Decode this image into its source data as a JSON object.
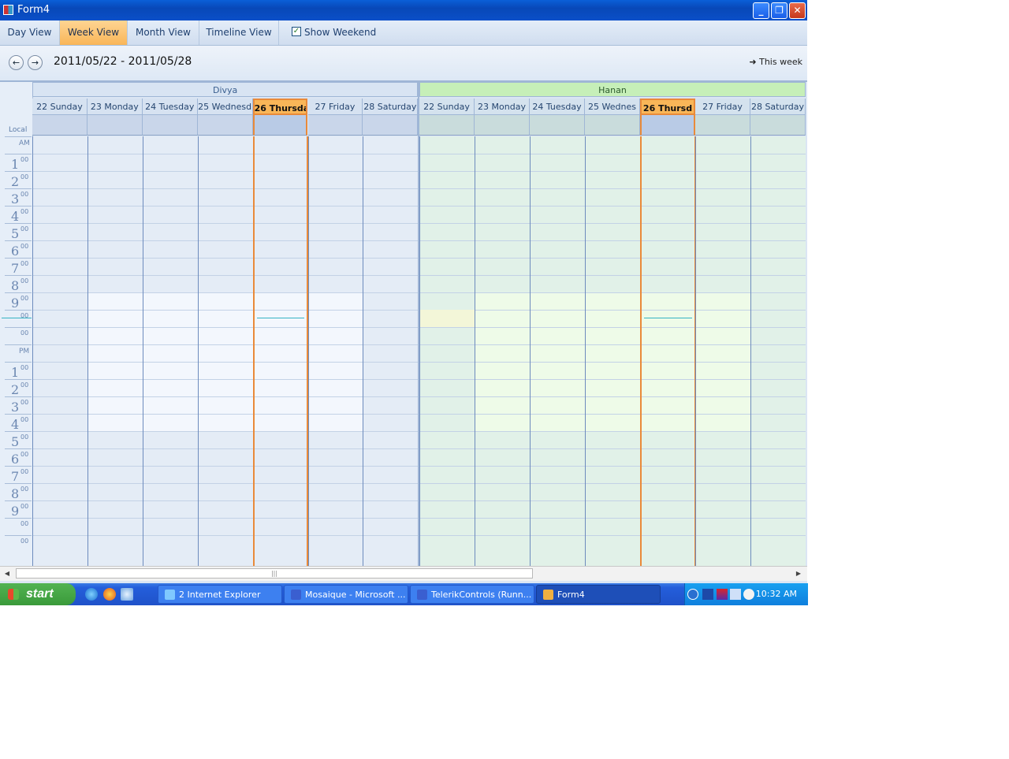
{
  "window": {
    "title": "Form4"
  },
  "title_buttons": {
    "minimize": "_",
    "restore": "❐",
    "close": "✕"
  },
  "toolbar": {
    "views": [
      "Day View",
      "Week View",
      "Month View",
      "Timeline View"
    ],
    "active_view": "Week View",
    "show_weekend_label": "Show Weekend",
    "show_weekend_checked": true
  },
  "nav": {
    "prev": "←",
    "next": "→",
    "date_range": "2011/05/22 - 2011/05/28",
    "this_week": "This week"
  },
  "scheduler": {
    "local_label": "Local",
    "resources": [
      {
        "name": "Divya",
        "color": "#d8e4f3",
        "text_color": "#3a5f8f",
        "days": [
          "22 Sunday",
          "23 Monday",
          "24 Tuesday",
          "25 Wednesd",
          "26 Thursda",
          "27 Friday",
          "28 Saturday"
        ]
      },
      {
        "name": "Hanan",
        "color": "#c6efb8",
        "text_color": "#2d5a2d",
        "days": [
          "22 Sunday",
          "23 Monday",
          "24 Tuesday",
          "25 Wednes",
          "26 Thursd",
          "27 Friday",
          "28 Saturday"
        ]
      }
    ],
    "today_index": 4,
    "time_labels": [
      {
        "h": "",
        "m": "",
        "ap": "AM"
      },
      {
        "h": "1",
        "m": "00"
      },
      {
        "h": "2",
        "m": "00"
      },
      {
        "h": "3",
        "m": "00"
      },
      {
        "h": "4",
        "m": "00"
      },
      {
        "h": "5",
        "m": "00"
      },
      {
        "h": "6",
        "m": "00"
      },
      {
        "h": "7",
        "m": "00"
      },
      {
        "h": "8",
        "m": "00"
      },
      {
        "h": "9",
        "m": "00"
      },
      {
        "h": "",
        "m": "00"
      },
      {
        "h": "",
        "m": "00"
      },
      {
        "h": "",
        "m": "",
        "ap": "PM"
      },
      {
        "h": "1",
        "m": "00"
      },
      {
        "h": "2",
        "m": "00"
      },
      {
        "h": "3",
        "m": "00"
      },
      {
        "h": "4",
        "m": "00"
      },
      {
        "h": "5",
        "m": "00"
      },
      {
        "h": "6",
        "m": "00"
      },
      {
        "h": "7",
        "m": "00"
      },
      {
        "h": "8",
        "m": "00"
      },
      {
        "h": "9",
        "m": "00"
      },
      {
        "h": "",
        "m": "00"
      },
      {
        "h": "",
        "m": "00"
      }
    ],
    "work_hours_start": 9,
    "work_hours_end": 17
  },
  "taskbar": {
    "start_label": "start",
    "tasks": [
      {
        "label": "2 Internet Explorer",
        "active": false
      },
      {
        "label": "Mosaique - Microsoft ...",
        "active": false
      },
      {
        "label": "TelerikControls (Runn...",
        "active": false
      },
      {
        "label": "Form4",
        "active": true
      }
    ],
    "clock": "10:32 AM"
  },
  "colors": {
    "today_accent": "#f9b658",
    "now_line": "#35b3c4"
  }
}
